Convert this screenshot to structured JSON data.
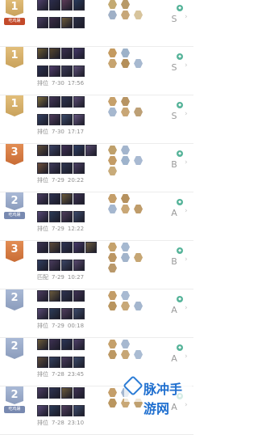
{
  "matches": [
    {
      "rank": "1",
      "tier": "gold",
      "tag": "吃鸡屠",
      "mode": "",
      "date": "",
      "time": "",
      "grade": "S",
      "champ_colors": [
        "#4d3f69",
        "#2c2d4c",
        "#5d3b58",
        "#293a5c",
        "#4a3e61",
        "#3b2c46",
        "#6b5a3a",
        "#2b2f45"
      ],
      "champ_labels": [],
      "item_colors": [
        "#c4aa72",
        "#b89a68",
        "#9fb0c7",
        "#c7a779",
        "#d7c49c"
      ]
    },
    {
      "rank": "1",
      "tier": "gold",
      "tag": "",
      "mode": "排位",
      "date": "7-30",
      "time": "17:56",
      "grade": "S",
      "champ_colors": [
        "#6a5a34",
        "#56462e",
        "#3a2f4f",
        "#45386a",
        "#2a2f4e",
        "#503d6b",
        "#3c3a57",
        "#5e5078"
      ],
      "champ_labels": [
        "",
        "",
        "",
        "",
        "",
        "",
        "",
        ""
      ],
      "item_colors": [
        "#c49a5f",
        "#9db2c9",
        "#c7a46f",
        "#b48f5a",
        "#a7b9d0"
      ]
    },
    {
      "rank": "1",
      "tier": "gold",
      "tag": "",
      "mode": "排位",
      "date": "7-30",
      "time": "17:17",
      "grade": "S",
      "champ_colors": [
        "#7a6a3c",
        "#433657",
        "#2d3350",
        "#5a4b73",
        "#344062",
        "#4e3b5b",
        "#3a4a6a",
        "#65557f"
      ],
      "champ_labels": [
        "",
        "",
        "",
        "",
        "",
        "",
        "",
        ""
      ],
      "item_colors": [
        "#c6a06a",
        "#b79463",
        "#a6b8cf",
        "#c8a676",
        "#bda076"
      ]
    },
    {
      "rank": "3",
      "tier": "bronze",
      "tag": "",
      "mode": "排位",
      "date": "7-29",
      "time": "20:22",
      "grade": "B",
      "champ_colors": [
        "#5e4d3a",
        "#3b4366",
        "#3f2f55",
        "#2c3c63",
        "#584a6f",
        "#6d4f3b",
        "#3f3a5c",
        "#2c3450",
        "#4b3e63"
      ],
      "champ_labels": [
        "",
        "",
        "",
        "",
        "",
        "",
        "",
        "",
        ""
      ],
      "item_colors": [
        "#bfa06b",
        "#a3b5cd",
        "#c39c66",
        "#9eb3cc",
        "#a9bad2",
        "#c8ab7a"
      ]
    },
    {
      "rank": "2",
      "tier": "silver",
      "tag": "吃鸡屠",
      "mode": "排位",
      "date": "7-29",
      "time": "12:22",
      "grade": "A",
      "champ_colors": [
        "#4a3c62",
        "#2e3251",
        "#6a5a3a",
        "#3d3152",
        "#564775",
        "#2b3a57",
        "#4f3c5c",
        "#3b4a6b"
      ],
      "champ_labels": [
        "",
        "",
        "",
        "",
        "",
        "",
        "",
        ""
      ],
      "item_colors": [
        "#c49e69",
        "#b5915e",
        "#a5b7cf",
        "#c9a776",
        "#bf9c6a"
      ]
    },
    {
      "rank": "3",
      "tier": "bronze",
      "tag": "",
      "mode": "匹配",
      "date": "7-29",
      "time": "10:27",
      "grade": "B",
      "champ_colors": [
        "#3c3453",
        "#5c4b3a",
        "#2c3252",
        "#47396a",
        "#6b5b3f",
        "#2f3d5f",
        "#4a3b5d",
        "#3a4566",
        "#5a4a70"
      ],
      "champ_labels": [
        "",
        "",
        "",
        "",
        "",
        "",
        "",
        "",
        ""
      ],
      "item_colors": [
        "#c5a26c",
        "#a5b8d0",
        "#bb9663",
        "#a2b4cb",
        "#c6a674",
        "#b9986a"
      ]
    },
    {
      "rank": "2",
      "tier": "silver",
      "tag": "",
      "mode": "排位",
      "date": "7-29",
      "time": "00:18",
      "grade": "A",
      "champ_colors": [
        "#4b3b60",
        "#6a5a3c",
        "#2e3350",
        "#3f3154",
        "#594a74",
        "#2c3b59",
        "#503d5e",
        "#3c4b6c"
      ],
      "champ_labels": [
        "",
        "",
        "",
        "",
        "",
        "",
        "",
        ""
      ],
      "item_colors": [
        "#c39d68",
        "#a8bad2",
        "#b9955f",
        "#c8a877",
        "#a4b6ce"
      ]
    },
    {
      "rank": "2",
      "tier": "silver",
      "tag": "",
      "mode": "排位",
      "date": "7-28",
      "time": "23:45",
      "grade": "A",
      "champ_colors": [
        "#6a5a3a",
        "#3d3152",
        "#2b3557",
        "#4f4069",
        "#5c4b3a",
        "#34405f",
        "#493a5c",
        "#3b4a6a"
      ],
      "champ_labels": [
        "",
        "",
        "",
        "",
        "",
        "",
        "",
        ""
      ],
      "item_colors": [
        "#c5a06a",
        "#a6b8d0",
        "#bc9863",
        "#c7a675",
        "#aabcd3"
      ]
    },
    {
      "rank": "2",
      "tier": "silver",
      "tag": "吃鸡屠",
      "mode": "排位",
      "date": "7-28",
      "time": "23:10",
      "grade": "A",
      "champ_colors": [
        "#4b3c62",
        "#2d3251",
        "#6b5b3b",
        "#3e3153",
        "#574876",
        "#2c3b58",
        "#503d5d",
        "#3c4b6c"
      ],
      "champ_labels": [],
      "item_colors": [
        "#c49e69",
        "#a5b7cf",
        "#ba965f",
        "#c8a776",
        "#bfa070"
      ]
    }
  ],
  "watermark": {
    "text": "脉冲手游网"
  }
}
